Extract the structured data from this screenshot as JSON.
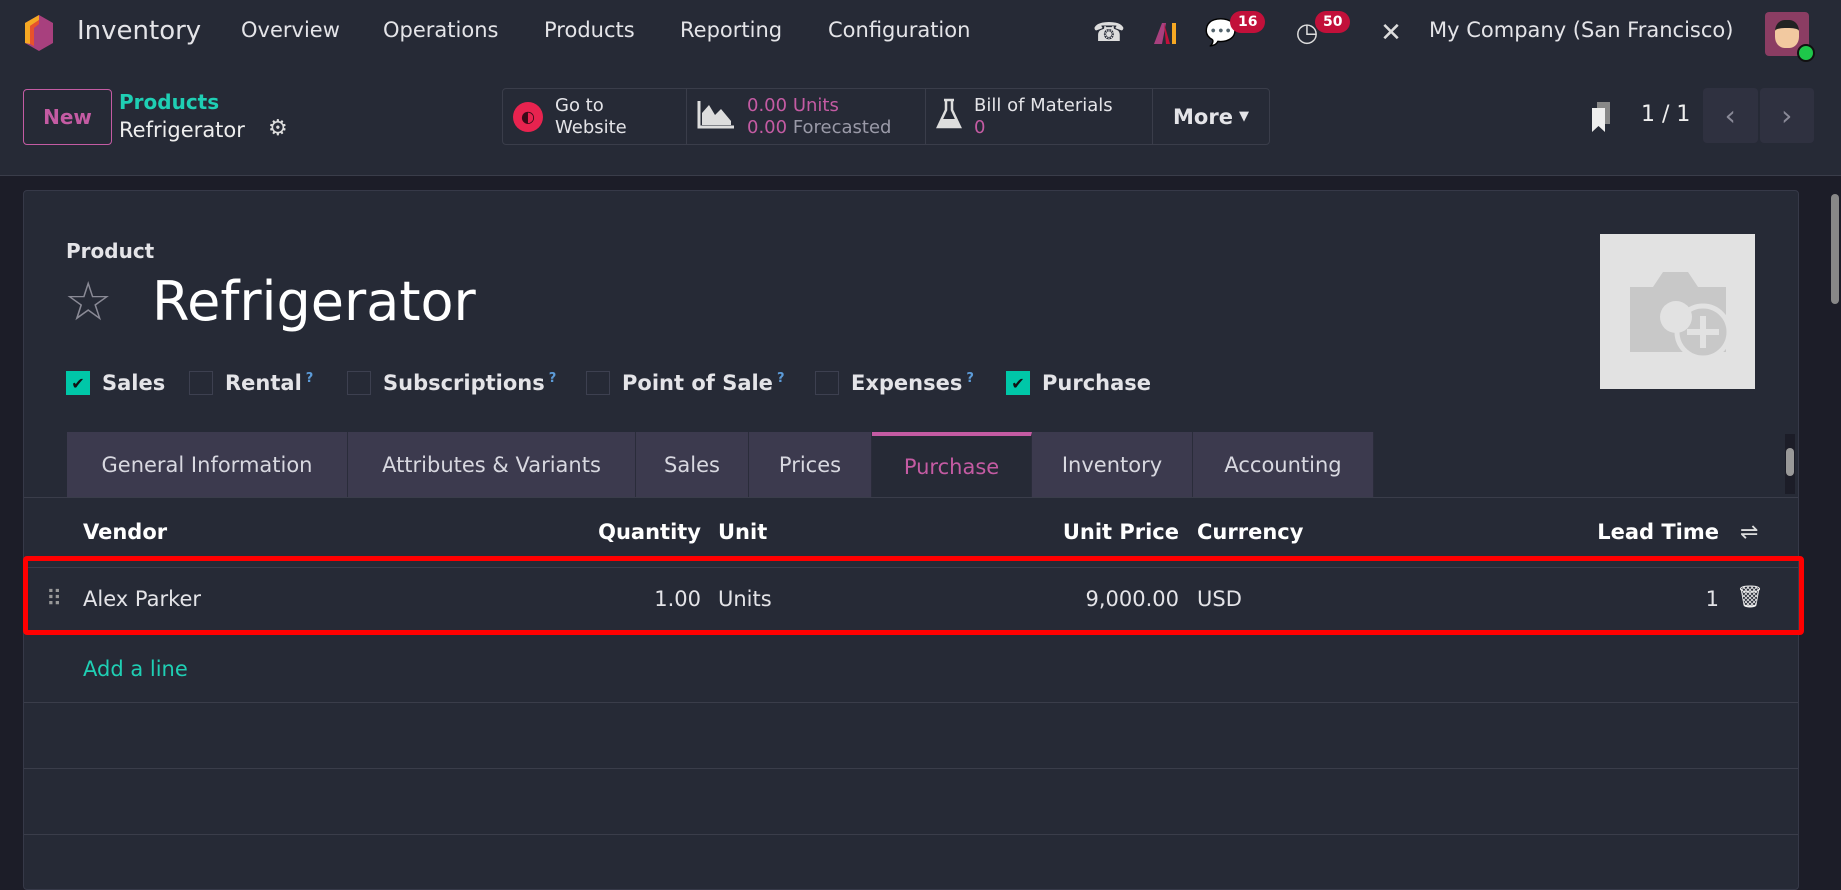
{
  "navbar": {
    "app_name": "Inventory",
    "menu": [
      "Overview",
      "Operations",
      "Products",
      "Reporting",
      "Configuration"
    ],
    "messages_count": "16",
    "activities_count": "50",
    "company": "My Company (San Francisco)"
  },
  "control_panel": {
    "new_label": "New",
    "breadcrumb_parent": "Products",
    "breadcrumb_current": "Refrigerator",
    "stats": {
      "website_line1": "Go to",
      "website_line2": "Website",
      "units_value": "0.00",
      "units_label": "Units",
      "forecast_value": "0.00",
      "forecast_label": "Forecasted",
      "bom_label": "Bill of Materials",
      "bom_value": "0",
      "more_label": "More"
    },
    "pager": "1 / 1"
  },
  "form": {
    "type_label": "Product",
    "name": "Refrigerator",
    "options": [
      {
        "label": "Sales",
        "checked": true,
        "help": ""
      },
      {
        "label": "Rental",
        "checked": false,
        "help": "?"
      },
      {
        "label": "Subscriptions",
        "checked": false,
        "help": "?"
      },
      {
        "label": "Point of Sale",
        "checked": false,
        "help": "?"
      },
      {
        "label": "Expenses",
        "checked": false,
        "help": "?"
      },
      {
        "label": "Purchase",
        "checked": true,
        "help": ""
      }
    ],
    "tabs": [
      "General Information",
      "Attributes & Variants",
      "Sales",
      "Prices",
      "Purchase",
      "Inventory",
      "Accounting"
    ],
    "active_tab": "Purchase",
    "table": {
      "headers": {
        "vendor": "Vendor",
        "quantity": "Quantity",
        "unit": "Unit",
        "unit_price": "Unit Price",
        "currency": "Currency",
        "lead_time": "Lead Time"
      },
      "rows": [
        {
          "vendor": "Alex Parker",
          "quantity": "1.00",
          "unit": "Units",
          "unit_price": "9,000.00",
          "currency": "USD",
          "lead_time": "1"
        }
      ],
      "add_line": "Add a line"
    }
  },
  "colors": {
    "accent": "#c45ba3",
    "teal": "#1fcfb4",
    "highlight": "#ff0000"
  }
}
